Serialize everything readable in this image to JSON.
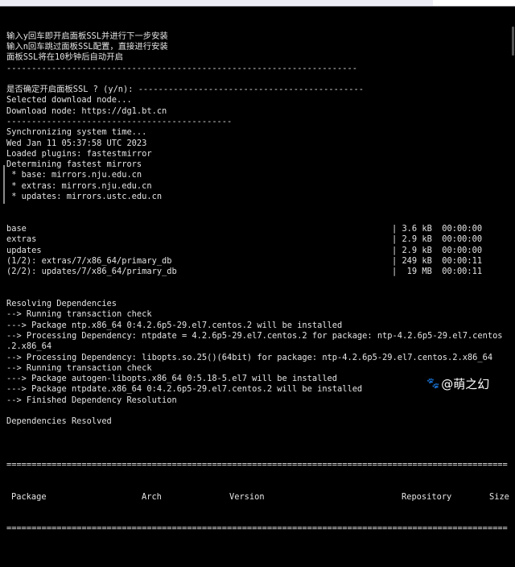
{
  "terminal": {
    "lines_top": [
      "输入y回车即开启面板SSL并进行下一步安装",
      "输入n回车跳过面板SSL配置，直接进行安装",
      "面板SSL将在10秒钟后自动开启",
      "----------------------------------------------------------------------",
      "",
      "是否确定开启面板SSL ? (y/n): ---------------------------------------------",
      "Selected download node...",
      "Download node: https://dg1.bt.cn",
      "---------------------------------------------",
      "Synchronizing system time...",
      "Wed Jan 11 05:37:58 UTC 2023",
      "Loaded plugins: fastestmirror",
      "Determining fastest mirrors",
      " * base: mirrors.nju.edu.cn",
      " * extras: mirrors.nju.edu.cn",
      " * updates: mirrors.ustc.edu.cn"
    ],
    "repo_rows": [
      {
        "name": "base",
        "size": "| 3.6 kB  00:00:00"
      },
      {
        "name": "extras",
        "size": "| 2.9 kB  00:00:00"
      },
      {
        "name": "updates",
        "size": "| 2.9 kB  00:00:00"
      },
      {
        "name": "(1/2): extras/7/x86_64/primary_db",
        "size": "| 249 kB  00:00:11"
      },
      {
        "name": "(2/2): updates/7/x86_64/primary_db",
        "size": "|  19 MB  00:00:11"
      }
    ],
    "lines_bottom": [
      "Resolving Dependencies",
      "--> Running transaction check",
      "---> Package ntp.x86_64 0:4.2.6p5-29.el7.centos.2 will be installed",
      "--> Processing Dependency: ntpdate = 4.2.6p5-29.el7.centos.2 for package: ntp-4.2.6p5-29.el7.centos",
      ".2.x86_64",
      "--> Processing Dependency: libopts.so.25()(64bit) for package: ntp-4.2.6p5-29.el7.centos.2.x86_64",
      "--> Running transaction check",
      "---> Package autogen-libopts.x86_64 0:5.18-5.el7 will be installed",
      "---> Package ntpdate.x86_64 0:4.2.6p5-29.el7.centos.2 will be installed",
      "--> Finished Dependency Resolution",
      "",
      "Dependencies Resolved",
      ""
    ],
    "separator": "====================================================================================================",
    "table_header": {
      "package": "Package",
      "arch": "Arch",
      "version": "Version",
      "repository": "Repository",
      "size": "Size"
    }
  },
  "watermark": {
    "text": "@萌之幻",
    "icon": "paw-icon"
  }
}
